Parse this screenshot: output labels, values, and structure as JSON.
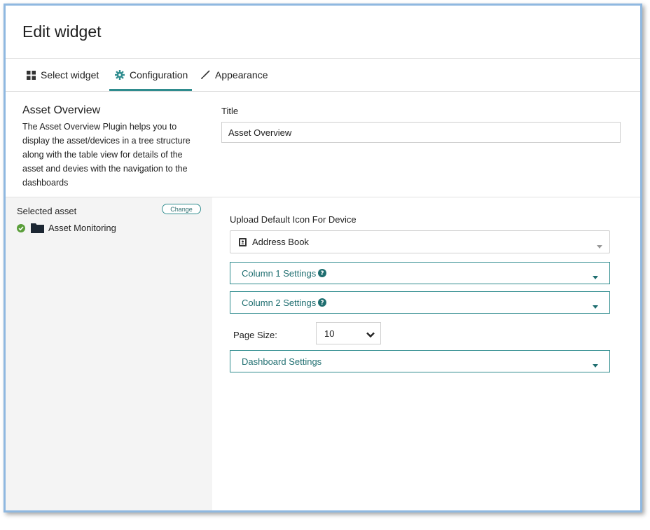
{
  "header": {
    "title": "Edit widget"
  },
  "tabs": [
    {
      "label": "Select widget",
      "icon": "grid-icon"
    },
    {
      "label": "Configuration",
      "icon": "gear-icon",
      "active": true
    },
    {
      "label": "Appearance",
      "icon": "brush-icon"
    }
  ],
  "intro": {
    "name": "Asset Overview",
    "description": "The Asset Overview Plugin helps you to display the asset/devices in a tree structure along with the table view for details of the asset and devies with the navigation to the dashboards"
  },
  "title_field": {
    "label": "Title",
    "value": "Asset Overview"
  },
  "selected_asset": {
    "label": "Selected asset",
    "change_label": "Change",
    "asset_name": "Asset Monitoring"
  },
  "upload_icon": {
    "label": "Upload Default Icon For Device",
    "selected": "Address Book"
  },
  "column1": {
    "label": "Column 1 Settings"
  },
  "column2": {
    "label": "Column 2 Settings"
  },
  "page_size": {
    "label": "Page Size:",
    "value": "10"
  },
  "dashboard": {
    "label": "Dashboard Settings"
  },
  "colors": {
    "accent": "#2f8c8e",
    "check": "#5a9e3a",
    "folder": "#1c2733"
  }
}
